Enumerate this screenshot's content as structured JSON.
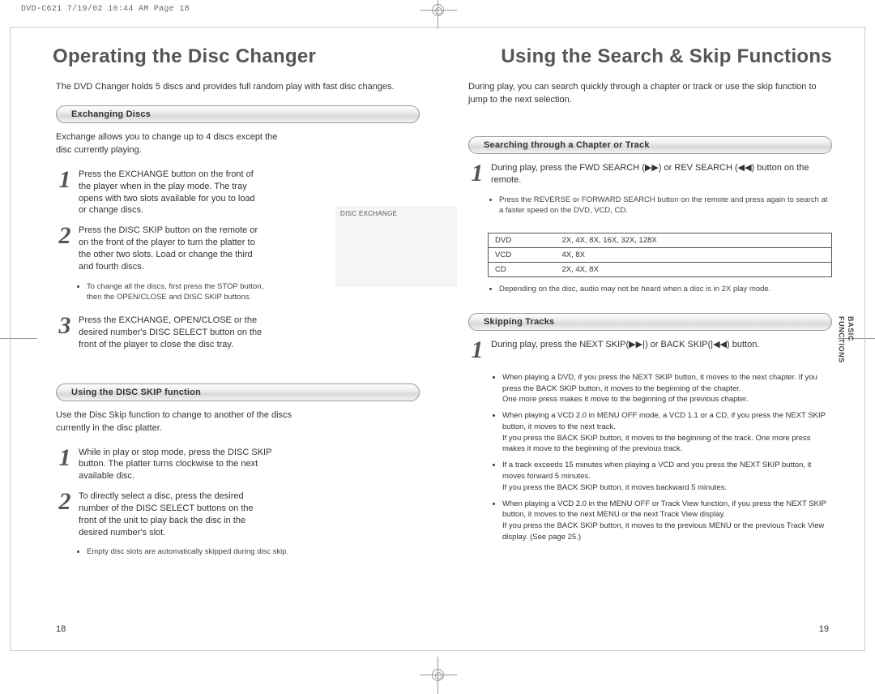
{
  "header_line": "DVD-C621  7/19/02 10:44 AM  Page 18",
  "left": {
    "title": "Operating the Disc Changer",
    "intro": "The DVD Changer holds 5 discs and provides full random play with fast disc changes.",
    "sectionA": {
      "pill": "Exchanging Discs",
      "text": "Exchange allows you to change up to 4 discs except the disc currently playing.",
      "step1": "Press the EXCHANGE button on the front of the player when in the play mode. The tray opens with two slots available for you to load or change discs.",
      "step2": "Press the DISC SKIP button on the remote or on the front of the player to turn the platter to the other two slots. Load or change the third and fourth discs.",
      "note2": "To change all the discs, first press the STOP button, then the OPEN/CLOSE and DISC SKIP buttons.",
      "step3": "Press the EXCHANGE, OPEN/CLOSE or the desired number's DISC SELECT button on the front of the player to close the disc tray.",
      "placeholder_label": "DISC EXCHANGE"
    },
    "sectionB": {
      "pill": "Using the DISC SKIP function",
      "text": "Use the Disc Skip function to change to another of the discs currently in the disc platter.",
      "step1": "While in play or stop mode, press the DISC SKIP button. The platter turns clockwise to the next available disc.",
      "step2": "To directly select a disc, press the desired number of the DISC SELECT buttons on the front of the unit to play back the disc in the desired number's slot.",
      "note2": "Empty disc slots are automatically skipped during disc skip."
    },
    "page_num": "18"
  },
  "right": {
    "title": "Using the Search & Skip Functions",
    "intro": "During play, you can search quickly through a chapter or track or use the skip function to jump to the next selection.",
    "sectionA": {
      "pill": "Searching through a Chapter or Track",
      "step1_a": "During play, press the FWD SEARCH (",
      "step1_b": ") or REV SEARCH (",
      "step1_c": ") button on the remote.",
      "note1": "Press the REVERSE or FORWARD SEARCH button on the remote and press again to search at a faster speed on the DVD, VCD, CD.",
      "table": {
        "r1a": "DVD",
        "r1b": "2X, 4X, 8X, 16X, 32X, 128X",
        "r2a": "VCD",
        "r2b": "4X, 8X",
        "r3a": "CD",
        "r3b": "2X, 4X, 8X"
      },
      "note2": "Depending on the disc, audio may not be heard when a disc is in 2X play mode."
    },
    "sectionB": {
      "pill": "Skipping Tracks",
      "step1_a": "During play, press the NEXT SKIP(",
      "step1_b": ") or BACK SKIP(",
      "step1_c": ") button.",
      "b1": "When playing a DVD, if you press the NEXT SKIP button, it moves to the next chapter. If you press the BACK SKIP button, it moves to the beginning of the chapter.",
      "b1b": "One more press makes it move to the beginning of the previous chapter.",
      "b2": "When playing a VCD 2.0 in MENU OFF mode, a VCD 1.1 or a CD, if you press the NEXT SKIP button, it moves to the next track.",
      "b2a": "If you press the BACK SKIP button, it moves to the beginning of the track. One more press makes it move to the beginning of the previous track.",
      "b3": "If a track exceeds 15 minutes when playing a VCD and you press the NEXT SKIP button, it moves forward 5 minutes.",
      "b3a": "If you press the BACK SKIP button, it moves backward 5 minutes.",
      "b4": "When playing a VCD 2.0 in the MENU OFF or Track View function, if you press the NEXT SKIP button, it moves to the next MENU or the next Track View display.",
      "b4a": "If you press the BACK SKIP button, it moves to the previous MENU or the previous Track View display. (See page 25.)"
    },
    "page_num": "19"
  },
  "side_tab_1": "BASIC",
  "side_tab_2": "FUNCTIONS",
  "icons": {
    "fwd": "▶▶",
    "rev": "◀◀",
    "next": "▶▶|",
    "back": "|◀◀"
  },
  "numbers": {
    "n1": "1",
    "n2": "2",
    "n3": "3"
  }
}
